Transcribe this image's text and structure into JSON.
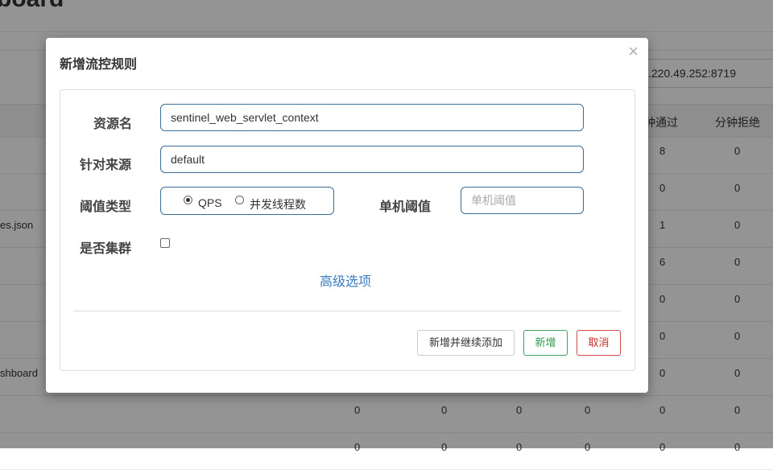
{
  "background": {
    "page_title": "board",
    "ip_value": ".220.49.252:8719",
    "headers": {
      "pass": "钟通过",
      "reject": "分钟拒绝"
    },
    "rows": [
      {
        "resource": "",
        "c1": "",
        "c2": "",
        "c3": "",
        "c4": "",
        "pass": "8",
        "reject": "0"
      },
      {
        "resource": "",
        "c1": "",
        "c2": "",
        "c3": "",
        "c4": "",
        "pass": "0",
        "reject": "0"
      },
      {
        "resource": "es.json",
        "c1": "",
        "c2": "",
        "c3": "",
        "c4": "",
        "pass": "1",
        "reject": "0"
      },
      {
        "resource": "",
        "c1": "",
        "c2": "",
        "c3": "",
        "c4": "",
        "pass": "6",
        "reject": "0"
      },
      {
        "resource": "",
        "c1": "",
        "c2": "",
        "c3": "",
        "c4": "",
        "pass": "0",
        "reject": "0"
      },
      {
        "resource": "",
        "c1": "",
        "c2": "",
        "c3": "",
        "c4": "",
        "pass": "0",
        "reject": "0"
      },
      {
        "resource": "shboard",
        "c1": "",
        "c2": "",
        "c3": "",
        "c4": "",
        "pass": "0",
        "reject": "0"
      },
      {
        "resource": "",
        "c1": "0",
        "c2": "0",
        "c3": "0",
        "c4": "0",
        "pass": "0",
        "reject": "0"
      },
      {
        "resource": "",
        "c1": "0",
        "c2": "0",
        "c3": "0",
        "c4": "0",
        "pass": "0",
        "reject": "0"
      }
    ]
  },
  "modal": {
    "title": "新增流控规则",
    "close": "×",
    "resource_label": "资源名",
    "resource_value": "sentinel_web_servlet_context",
    "source_label": "针对来源",
    "source_value": "default",
    "threshold_type_label": "阈值类型",
    "threshold_type_options": [
      "QPS",
      "并发线程数"
    ],
    "threshold_type_selected": "QPS",
    "single_threshold_label": "单机阈值",
    "single_threshold_placeholder": "单机阈值",
    "cluster_label": "是否集群",
    "advanced_link": "高级选项",
    "buttons": {
      "add_continue": "新增并继续添加",
      "add": "新增",
      "cancel": "取消"
    }
  }
}
